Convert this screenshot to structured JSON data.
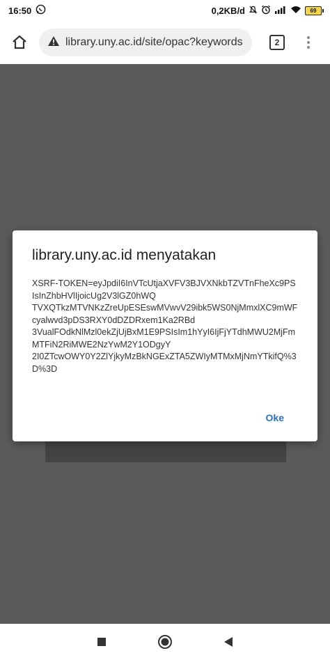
{
  "status_bar": {
    "time": "16:50",
    "network_speed": "0,2KB/d",
    "battery": "69"
  },
  "browser": {
    "url": "library.uny.ac.id/site/opac?keywords",
    "tab_count": "2"
  },
  "dialog": {
    "title": "library.uny.ac.id menyatakan",
    "message": "XSRF-TOKEN=eyJpdiI6InVTcUtjaXVFV3BJVXNkbTZVTnFheXc9PSIsInZhbHVlIjoicUg2V3lGZ0hWQ\nTVXQTkzMTVNKzZreUpESEswMVwvV29ibk5WS0NjMmxlXC9mWFcyalwvd3pDS3RXY0dDZDRxem1Ka2RBd\n3VualFOdkNlMzl0ekZjUjBxM1E9PSIsIm1hYyI6IjFjYTdhMWU2MjFmMTFiN2RiMWE2NzYwM2Y1ODgyY\n2I0ZTcwOWY0Y2ZlYjkyMzBkNGExZTA5ZWIyMTMxMjNmYTkifQ%3D%3D",
    "ok_label": "Oke"
  },
  "colors": {
    "accent": "#2a6fc9",
    "page_dim": "#5b5b5b"
  }
}
